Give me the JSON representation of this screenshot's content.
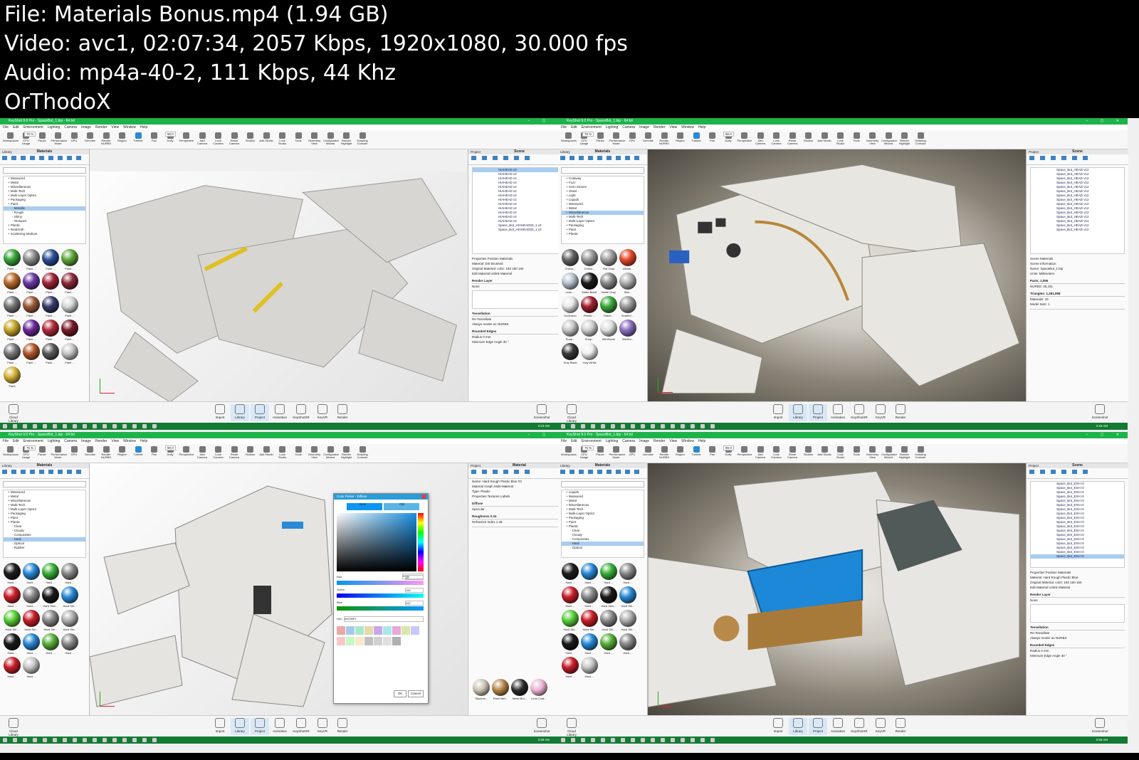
{
  "header": {
    "line1": "File: Materials Bonus.mp4 (1.94 GB)",
    "line2": "Video: avc1, 02:07:34, 2057 Kbps, 1920x1080, 30.000 fps",
    "line3": "Audio: mp4a-40-2, 111 Kbps, 44 Khz",
    "line4": "OrThodoX"
  },
  "app": {
    "title": "KeyShot 9.0 Pro - SpaceBot_1.bip - 64 bit",
    "window_controls": "–  ▢  ✕",
    "menu": [
      "File",
      "Edit",
      "Environment",
      "Lighting",
      "Camera",
      "Image",
      "Render",
      "View",
      "Window",
      "Help"
    ],
    "toolbar": [
      "Workspaces",
      "CPU Usage",
      "Pause",
      "Performance Mode",
      "GPU",
      "Denoise",
      "Render NURBS",
      "Region",
      "Tumble",
      "Pan",
      "Dolly",
      "Perspective",
      "Add Camera",
      "Lock Camera",
      "Reset Camera",
      "Studios",
      "Add Studio",
      "Lock Studio",
      "Tools",
      "Geometry View",
      "Configurator Wizard",
      "Render Highlight",
      "Scripting Console"
    ],
    "zoom": "75 %",
    "fov": "90.0",
    "ribbon": [
      "Cloud Library",
      "Import",
      "Library",
      "Project",
      "Animation",
      "KeyShotXR",
      "KeyVR",
      "Render",
      "Screenshot"
    ]
  },
  "quads": [
    {
      "library_title": "Library",
      "library_header": "Materials",
      "tree": [
        "Measured",
        "Metal",
        "Miscellaneous",
        "Multi-Tech",
        "Multi-Layer Optics",
        "Packaging",
        "Paint",
        "Metallic",
        "Rough",
        "Shiny",
        "Textured",
        "Plastic",
        "Realcloth",
        "Scattering Medium"
      ],
      "tree_selected": 7,
      "swatches": [
        {
          "label": "Paint ...",
          "color": "#3aa53a"
        },
        {
          "label": "Paint ...",
          "color": "#8e8e8e"
        },
        {
          "label": "Paint ...",
          "color": "#2e4f9a"
        },
        {
          "label": "Paint ...",
          "color": "#5ea83a"
        },
        {
          "label": "Paint ...",
          "color": "#b86a2a"
        },
        {
          "label": "Paint ...",
          "color": "#6a3aa5"
        },
        {
          "label": "Paint ...",
          "color": "#a02438"
        },
        {
          "label": "Paint ...",
          "color": "#8a2a3a"
        },
        {
          "label": "Paint ...",
          "color": "#777777"
        },
        {
          "label": "Paint ...",
          "color": "#9a5a3a"
        },
        {
          "label": "Paint ...",
          "color": "#3a3a6a"
        },
        {
          "label": "Paint ...",
          "color": "#d8d8d8"
        },
        {
          "label": "Paint ...",
          "color": "#c8a82a"
        },
        {
          "label": "Paint ...",
          "color": "#6a2a9a"
        },
        {
          "label": "Paint ...",
          "color": "#b02a3a"
        },
        {
          "label": "Paint ...",
          "color": "#7a1a2a"
        },
        {
          "label": "Paint ...",
          "color": "#7a7a7a"
        },
        {
          "label": "Paint ...",
          "color": "#b0582a"
        },
        {
          "label": "Paint ...",
          "color": "#5a5a5a"
        },
        {
          "label": "Paint ...",
          "color": "#c8c8c8"
        },
        {
          "label": "Paint",
          "color": "#d4b43a"
        }
      ],
      "scene_title": "Scene",
      "scene_items": [
        "HiAHEAD v2",
        "HiAHEAD v2",
        "HiAHEAD v2",
        "HiAHEAD v2",
        "HiAHEAD v2",
        "HiAHEAD v2",
        "HiAHEAD v2",
        "HiAHEAD v2",
        "HiAHEAD v2",
        "HiAHEAD v2",
        "HiAHEAD v2",
        "HiAHEAD v2",
        "HiAHEAD v2",
        "Space_Bot_HIAHEAD03_1 v2",
        "Space_Bot_HIAHEAD03_1 v2"
      ],
      "scene_selected": 0,
      "props": {
        "tabs": "Properties   Position   Materials",
        "material": "Material:        Dirt Brushed",
        "original": "Original Material:  color: 160 160 160",
        "buttons": "Edit Material     Unlink Material",
        "render_layer": "Render Layer",
        "layer_none": "None",
        "tessellation": "Tessellation",
        "retessellate": "Re-Tessellate",
        "always_nurbs": "Always render as NURBS",
        "rounded_edges": "Rounded Edges",
        "radius": "Radius        0 mm",
        "min_edge": "Minimum Edge Angle    30 °"
      },
      "clock": "3:23 AM",
      "scene_bg": "light"
    },
    {
      "library_title": "Library",
      "library_header": "Materials",
      "tree": [
        "Cutaway",
        "Fuzz",
        "Gem Stones",
        "Glass",
        "Light",
        "Liquids",
        "Measured",
        "Metal",
        "Miscellaneous",
        "Multi-Tech",
        "Multi-Layer Optics",
        "Packaging",
        "Paint",
        "Plastic"
      ],
      "tree_selected": 8,
      "swatches": [
        {
          "label": "Check...",
          "color": "#666666"
        },
        {
          "label": "Check...",
          "color": "#999999"
        },
        {
          "label": "Flat Gray",
          "color": "#a0a0a0"
        },
        {
          "label": "Infrare...",
          "color": "#e84a2a"
        },
        {
          "label": "Lens ...",
          "color": "#b8c4d0"
        },
        {
          "label": "Matte Black",
          "color": "#1a1a1a"
        },
        {
          "label": "Matte Gray",
          "color": "#8a8a8a"
        },
        {
          "label": "Mat...",
          "color": "#b0b0b0"
        },
        {
          "label": "Occlusion",
          "color": "#e8e8e8"
        },
        {
          "label": "Plastic ...",
          "color": "#a02030"
        },
        {
          "label": "Rainb...",
          "color": "#3aa83a"
        },
        {
          "label": "Shaded ...",
          "color": "#9a9a9a"
        },
        {
          "label": "Soap...",
          "color": "#c8c8c8"
        },
        {
          "label": "Soap...",
          "color": "#d0d0d0"
        },
        {
          "label": "Wireframe",
          "color": "#e0e0e0"
        },
        {
          "label": "Wirefra...",
          "color": "#8a70c0"
        },
        {
          "label": "Xray Black",
          "color": "#3a3a3a"
        },
        {
          "label": "Xray White",
          "color": "#f0f0f0"
        }
      ],
      "scene_title": "Scene",
      "scene_items": [
        "Space_Bot_HEAD v12",
        "Space_Bot_HEAD v12",
        "Space_Bot_HEAD v12",
        "Space_Bot_HEAD v12",
        "Space_Bot_HEAD v12",
        "Space_Bot_HEAD v12",
        "Space_Bot_HEAD v12",
        "Space_Bot_HEAD v12",
        "Space_Bot_HEAD v12",
        "Space_Bot_HEAD v12",
        "Space_Bot_HEAD v12",
        "Space_Bot_HEAD v12",
        "Space_Bot_HEAD v12",
        "Space_Bot_HEAD v12",
        "Space_Bot_HEAD v12"
      ],
      "scene_selected": -1,
      "props": {
        "tabs": "Scene   Materials",
        "material": "Scene Information",
        "original": "Name:    SpaceBot_1.bip",
        "buttons": "Units:    Millimeters",
        "render_layer": "Parts:    1,095",
        "layer_none": "NURBS:    25,431",
        "tessellation": "Triangles:    1,281,998",
        "retessellate": "Materials:    15",
        "always_nurbs": "Model Sets:    1",
        "rounded_edges": "",
        "radius": "",
        "min_edge": ""
      },
      "clock": "3:45 AM",
      "scene_bg": "dark"
    },
    {
      "library_title": "Library",
      "library_header": "Materials",
      "tree": [
        "Measured",
        "Metal",
        "Miscellaneous",
        "Multi-Tech",
        "Multi-Layer Optics",
        "Packaging",
        "Paint",
        "Plastic",
        "Clear",
        "Cloudy",
        "Composites",
        "Hard",
        "Optical",
        "Rubber"
      ],
      "tree_selected": 11,
      "swatches": [
        {
          "label": "Hard ...",
          "color": "#1e1e1e"
        },
        {
          "label": "Hard ...",
          "color": "#2a8ad6"
        },
        {
          "label": "Hard ...",
          "color": "#3ab03a"
        },
        {
          "label": "Hard ...",
          "color": "#8a8a8a"
        },
        {
          "label": "Hard ...",
          "color": "#c8202a"
        },
        {
          "label": "Hard ...",
          "color": "#8a8a8a"
        },
        {
          "label": "Hard Shin...",
          "color": "#1a1a1a"
        },
        {
          "label": "Hard Shi...",
          "color": "#2a8ad6"
        },
        {
          "label": "Hard Shi...",
          "color": "#5ad03a"
        },
        {
          "label": "Hard Shi...",
          "color": "#c8202a"
        },
        {
          "label": "Hard Shi...",
          "color": "#8a8a8a"
        },
        {
          "label": "Hard Shi...",
          "color": "#b0b0b0"
        },
        {
          "label": "Hard ...",
          "color": "#1a1a1a"
        },
        {
          "label": "Hard ...",
          "color": "#2a8ad6"
        },
        {
          "label": "Hard ...",
          "color": "#5ab03a"
        },
        {
          "label": "Hard ...",
          "color": "#8a8a8a"
        },
        {
          "label": "Hard ...",
          "color": "#c8202a"
        },
        {
          "label": "Hard ...",
          "color": "#c8c8c8"
        }
      ],
      "scene_title": "Material",
      "scene_items": [],
      "scene_selected": -1,
      "props": {
        "tabs": "Name:  Hard Rough Plastic Blue #3",
        "material": "Material Graph      Multi-Material",
        "original": "Type:       Plastic",
        "buttons": "Properties    Textures    Labels",
        "render_layer": "Diffuse",
        "layer_none": "Specular",
        "tessellation": "Roughness       0.15",
        "retessellate": "Refractive Index    1.46",
        "always_nurbs": "",
        "rounded_edges": "",
        "radius": "",
        "min_edge": ""
      },
      "bottom_swatches": [
        "Titanium...",
        "Paint Met...",
        "Metal Bru...",
        "Lens Coat..."
      ],
      "picker": {
        "title": "Color Picker - Diffuse",
        "new": "New",
        "old": "Old",
        "mode": "RGB",
        "red": "Red",
        "red_val": "12",
        "green": "Green",
        "green_val": "150",
        "blue": "Blue",
        "blue_val": "242",
        "hex_label": "Hex:",
        "hex": "#0C96F2",
        "ok": "OK",
        "cancel": "Cancel"
      },
      "clock": "3:38 AM",
      "scene_bg": "light"
    },
    {
      "library_title": "Library",
      "library_header": "Materials",
      "tree": [
        "Liquids",
        "Measured",
        "Metal",
        "Miscellaneous",
        "Multi-Tech",
        "Multi-Layer Optics",
        "Packaging",
        "Paint",
        "Plastic",
        "Clear",
        "Cloudy",
        "Composites",
        "Hard",
        "Optical"
      ],
      "tree_selected": 12,
      "swatches": [
        {
          "label": "Hard ...",
          "color": "#1e1e1e"
        },
        {
          "label": "Hard ...",
          "color": "#2a8ad6"
        },
        {
          "label": "Hard ...",
          "color": "#3ab03a"
        },
        {
          "label": "Hard ...",
          "color": "#8a8a8a"
        },
        {
          "label": "Hard ...",
          "color": "#c8202a"
        },
        {
          "label": "Hard ...",
          "color": "#8a8a8a"
        },
        {
          "label": "Hard Shin...",
          "color": "#1a1a1a"
        },
        {
          "label": "Hard Shi...",
          "color": "#2a8ad6"
        },
        {
          "label": "Hard Shi...",
          "color": "#5ad03a"
        },
        {
          "label": "Hard Shi...",
          "color": "#c8202a"
        },
        {
          "label": "Hard Shi...",
          "color": "#8a8a8a"
        },
        {
          "label": "Hard Shi...",
          "color": "#b0b0b0"
        },
        {
          "label": "Hard ...",
          "color": "#1a1a1a"
        },
        {
          "label": "Hard ...",
          "color": "#2a8ad6"
        },
        {
          "label": "Hard ...",
          "color": "#5ab03a"
        },
        {
          "label": "Hard ...",
          "color": "#8a8a8a"
        },
        {
          "label": "Hard ...",
          "color": "#c8202a"
        },
        {
          "label": "Hard ...",
          "color": "#c8c8c8"
        }
      ],
      "scene_title": "Scene",
      "scene_items": [
        "Space_Bot_ESH nl",
        "Space_Bot_ESH nl",
        "Space_Bot_ESH nl",
        "Space_Bot_ESH nl",
        "Space_Bot_ESH nl",
        "Space_Bot_ESH nl",
        "Space_Bot_ESH nl",
        "Space_Bot_ESH nl",
        "Space_Bot_ESH nl",
        "Space_Bot_ESH nl",
        "Space_Bot_ESH nl",
        "Space_Bot_ESH nl",
        "Space_Bot_ESH nl",
        "Space_Bot_ESH nl",
        "Space_Bot_ESH nl",
        "Space_Bot_ESH nl",
        "Space_Bot_ESH nl",
        "Space_Bot_ESH nl"
      ],
      "scene_selected": 17,
      "props": {
        "tabs": "Properties   Position   Materials",
        "material": "Material:     Hard Rough Plastic Blue",
        "original": "Original Material:  color: 160 160 160",
        "buttons": "Edit Material     Unlink Material",
        "render_layer": "Render Layer",
        "layer_none": "None",
        "tessellation": "Tessellation",
        "retessellate": "Re-Tessellate",
        "always_nurbs": "Always render as NURBS",
        "rounded_edges": "Rounded Edges",
        "radius": "Radius        0 mm",
        "min_edge": "Minimum Edge Angle    30 °"
      },
      "clock": "3:56 AM",
      "scene_bg": "dark"
    }
  ]
}
